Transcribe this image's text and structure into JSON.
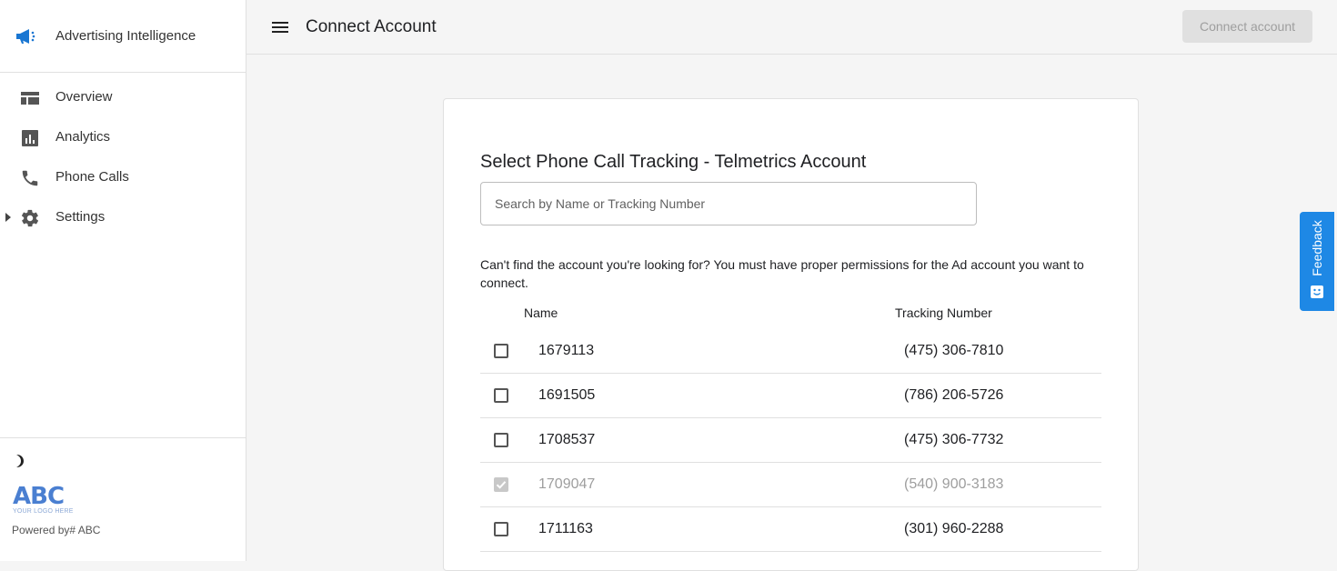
{
  "app": {
    "title": "Advertising Intelligence",
    "brand_color": "#1976d2"
  },
  "sidebar": {
    "items": [
      {
        "label": "Overview",
        "icon": "dashboard-icon"
      },
      {
        "label": "Analytics",
        "icon": "analytics-icon"
      },
      {
        "label": "Phone Calls",
        "icon": "phone-icon"
      },
      {
        "label": "Settings",
        "icon": "gear-icon",
        "expandable": true
      }
    ],
    "footer": {
      "logo_text": "ABC",
      "logo_subtext": "YOUR LOGO HERE",
      "powered_by": "Powered by# ABC"
    }
  },
  "header": {
    "title": "Connect Account",
    "connect_button": "Connect account"
  },
  "card": {
    "title": "Select Phone Call Tracking - Telmetrics Account",
    "search_placeholder": "Search by Name or Tracking Number",
    "notice": "Can't find the account you're looking for? You must have proper permissions for the Ad account you want to connect.",
    "columns": {
      "name": "Name",
      "tracking": "Tracking Number"
    },
    "rows": [
      {
        "name": "1679113",
        "tracking": "(475) 306-7810",
        "checked": false,
        "disabled": false
      },
      {
        "name": "1691505",
        "tracking": "(786) 206-5726",
        "checked": false,
        "disabled": false
      },
      {
        "name": "1708537",
        "tracking": "(475) 306-7732",
        "checked": false,
        "disabled": false
      },
      {
        "name": "1709047",
        "tracking": "(540) 900-3183",
        "checked": true,
        "disabled": true
      },
      {
        "name": "1711163",
        "tracking": "(301) 960-2288",
        "checked": false,
        "disabled": false
      }
    ]
  },
  "feedback": {
    "label": "Feedback",
    "color": "#1e88e5"
  }
}
